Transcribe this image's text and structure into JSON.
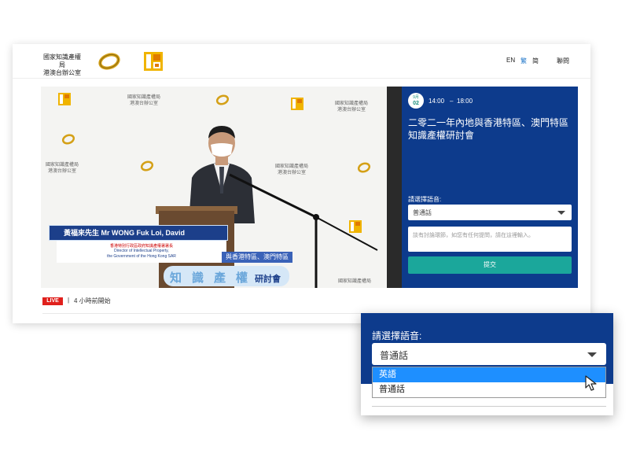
{
  "header": {
    "org_line1": "國家知識產權局",
    "org_line2": "港澳台辦公室",
    "lang_en": "EN",
    "lang_tc": "繁",
    "lang_sc": "简",
    "contact": "聯問"
  },
  "video": {
    "backdrop_org_line1": "國家知識產權局",
    "backdrop_org_line2": "港澳台辦公室",
    "speaker_name": "黃福來先生 Mr WONG Fuk Loi, David",
    "speaker_title_zh": "香港特別行政區政府知識產權署署長",
    "speaker_title_en1": "Director of Intellectual Property,",
    "speaker_title_en2": "the Government of the Hong Kong SAR",
    "sub_banner": "與香港特區、澳門特區",
    "banner_chars": [
      "知",
      "識",
      "產",
      "權"
    ],
    "banner_tail": "研討會"
  },
  "panel": {
    "date_month": "9月",
    "date_day": "02",
    "time_start": "14:00",
    "time_dash": "–",
    "time_end": "18:00",
    "event_title": "二零二一年內地與香港特區、澳門特區知識產權研討會",
    "language_label": "請選擇語音:",
    "language_value": "普通話",
    "comment_placeholder": "談有討論環節，如您有任何提問，請在這裡輸入。",
    "submit_label": "提交"
  },
  "status": {
    "live_badge": "LIVE",
    "separator": "|",
    "countdown": "4 小時前開始"
  },
  "zoom": {
    "label": "請選擇語音:",
    "select_value": "普通話",
    "options": [
      "英語",
      "普通話"
    ]
  },
  "colors": {
    "panel_blue": "#0d3b8c",
    "submit_teal": "#1ba79b",
    "live_red": "#e0201c",
    "option_highlight": "#1e8fff"
  }
}
